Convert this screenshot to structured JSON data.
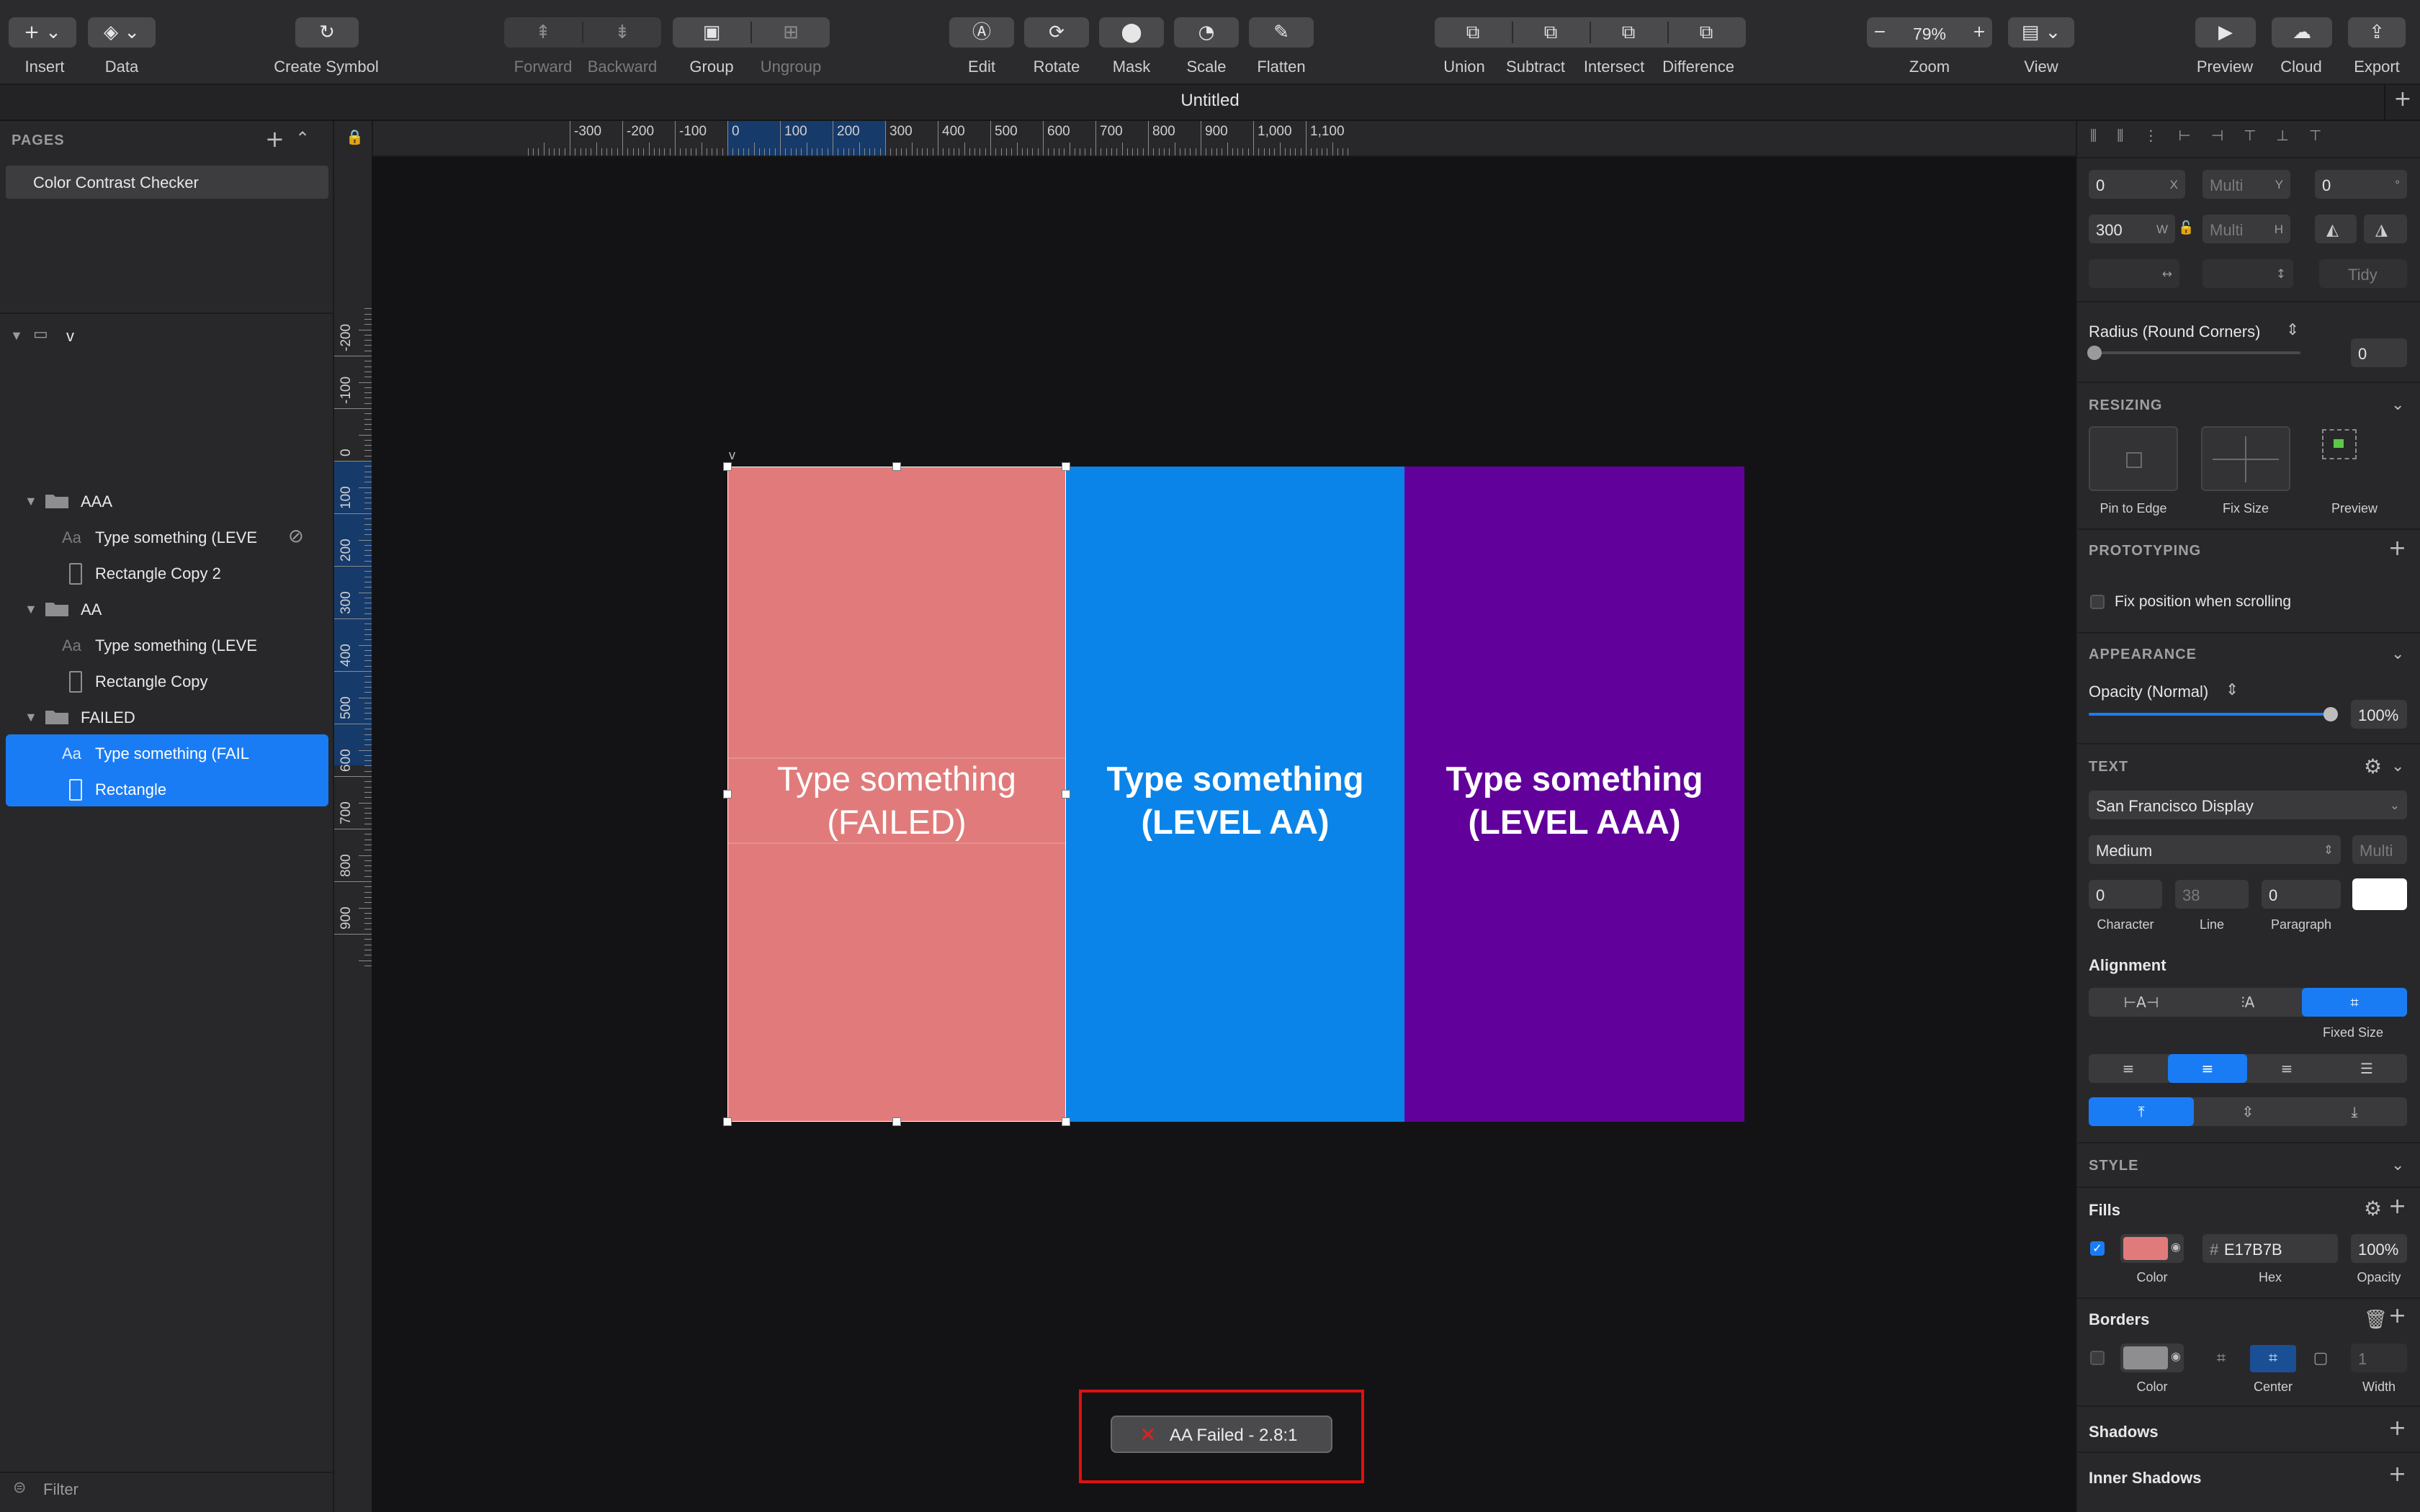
{
  "toolbar": {
    "insert": "Insert",
    "data": "Data",
    "create_symbol": "Create Symbol",
    "forward": "Forward",
    "backward": "Backward",
    "group": "Group",
    "ungroup": "Ungroup",
    "edit": "Edit",
    "rotate": "Rotate",
    "mask": "Mask",
    "scale": "Scale",
    "flatten": "Flatten",
    "union": "Union",
    "subtract": "Subtract",
    "intersect": "Intersect",
    "difference": "Difference",
    "zoom_label": "Zoom",
    "zoom_value": "79%",
    "view": "View",
    "preview": "Preview",
    "cloud": "Cloud",
    "export": "Export"
  },
  "document": {
    "title": "Untitled"
  },
  "pages": {
    "header": "PAGES",
    "items": [
      "Color Contrast Checker"
    ]
  },
  "layers": {
    "artboard": "v",
    "groups": [
      {
        "name": "AAA",
        "children": [
          "Type something (LEVE",
          "Rectangle Copy 2"
        ]
      },
      {
        "name": "AA",
        "children": [
          "Type something (LEVE",
          "Rectangle Copy"
        ]
      },
      {
        "name": "FAILED",
        "children": [
          "Type something (FAIL",
          "Rectangle"
        ]
      }
    ],
    "text_icon": "Aa",
    "filter": "Filter"
  },
  "rulers": {
    "h_ticks": [
      "-300",
      "-200",
      "-100",
      "0",
      "100",
      "200",
      "300",
      "400",
      "500",
      "600",
      "700",
      "800",
      "900",
      "1,000",
      "1,100"
    ],
    "v_ticks": [
      "-200",
      "-100",
      "0",
      "100",
      "200",
      "300",
      "400",
      "500",
      "600",
      "700",
      "800",
      "900"
    ],
    "h_highlight": [
      0,
      300
    ],
    "v_highlight": [
      0,
      580
    ]
  },
  "canvas": {
    "artboard_label": "v",
    "panels": [
      {
        "line1": "Type something",
        "line2": "(FAILED)",
        "color": "#E17B7B",
        "weight": "normal"
      },
      {
        "line1": "Type something",
        "line2": "(LEVEL AA)",
        "color": "#0A84E8",
        "weight": "bold"
      },
      {
        "line1": "Type something",
        "line2": "(LEVEL AAA)",
        "color": "#62009B",
        "weight": "bold"
      }
    ],
    "status": {
      "icon": "✕",
      "text": "AA Failed - 2.8:1"
    }
  },
  "inspector": {
    "x": "0",
    "x_unit": "X",
    "y": "Multi",
    "y_unit": "Y",
    "rotation": "0",
    "rotation_unit": "°",
    "w": "300",
    "w_unit": "W",
    "h": "Multi",
    "h_unit": "H",
    "tidy": "Tidy",
    "radius_label": "Radius (Round Corners)",
    "radius_value": "0",
    "resizing": "RESIZING",
    "pin_to_edge": "Pin to Edge",
    "fix_size": "Fix Size",
    "preview": "Preview",
    "prototyping": "PROTOTYPING",
    "fix_position": "Fix position when scrolling",
    "appearance": "APPEARANCE",
    "opacity_label": "Opacity (Normal)",
    "opacity_value": "100%",
    "opacity_level": 1.0,
    "text_header": "TEXT",
    "font_family": "San Francisco Display",
    "font_weight": "Medium",
    "font_size": "Multi",
    "character": "0",
    "line": "38",
    "paragraph": "0",
    "character_label": "Character",
    "line_label": "Line",
    "paragraph_label": "Paragraph",
    "alignment": "Alignment",
    "fixed_size": "Fixed Size",
    "style": "STYLE",
    "fills": "Fills",
    "fill_hex_prefix": "#",
    "fill_hex": "E17B7B",
    "fill_color": "#E17B7B",
    "fill_opacity": "100%",
    "color_label": "Color",
    "hex_label": "Hex",
    "opacity_col_label": "Opacity",
    "borders": "Borders",
    "border_width": "1",
    "center_label": "Center",
    "width_label": "Width",
    "shadows": "Shadows",
    "inner_shadows": "Inner Shadows"
  }
}
